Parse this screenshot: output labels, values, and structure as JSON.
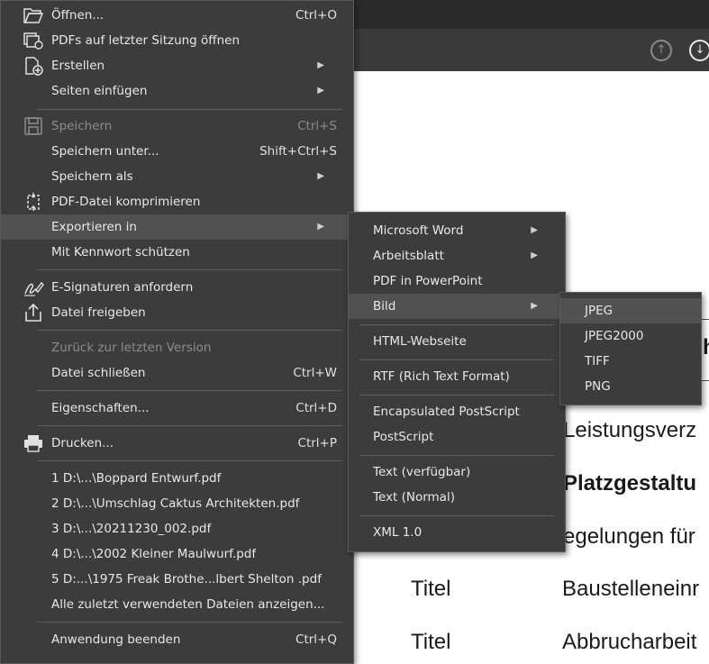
{
  "toolbar": {
    "up_icon": "arrow-up-circle-icon",
    "down_icon": "arrow-down-circle-icon"
  },
  "document": {
    "lines": [
      "Leistungsverz",
      "Platzgestaltu",
      "egelungen für",
      "Titel",
      "Baustelleneinr",
      "Titel",
      "Abbrucharbeit",
      "h"
    ]
  },
  "file_menu": {
    "items": [
      {
        "label": "Öffnen...",
        "shortcut": "Ctrl+O",
        "icon": "folder-open-icon"
      },
      {
        "label": "PDFs auf letzter Sitzung öffnen",
        "icon": "pdf-session-icon"
      },
      {
        "label": "Erstellen",
        "icon": "create-pdf-icon"
      },
      {
        "label": "Seiten einfügen"
      },
      {
        "label": "Speichern",
        "shortcut": "Ctrl+S",
        "icon": "save-icon"
      },
      {
        "label": "Speichern unter...",
        "shortcut": "Shift+Ctrl+S"
      },
      {
        "label": "Speichern als"
      },
      {
        "label": "PDF-Datei komprimieren",
        "icon": "compress-icon"
      },
      {
        "label": "Exportieren in"
      },
      {
        "label": "Mit Kennwort schützen"
      },
      {
        "label": "E-Signaturen anfordern",
        "icon": "signature-icon"
      },
      {
        "label": "Datei freigeben",
        "icon": "share-icon"
      },
      {
        "label": "Zurück zur letzten Version"
      },
      {
        "label": "Datei schließen",
        "shortcut": "Ctrl+W"
      },
      {
        "label": "Eigenschaften...",
        "shortcut": "Ctrl+D"
      },
      {
        "label": "Drucken...",
        "shortcut": "Ctrl+P",
        "icon": "printer-icon"
      },
      {
        "label": "1 D:\\...\\Boppard Entwurf.pdf"
      },
      {
        "label": "2 D:\\...\\Umschlag Caktus Architekten.pdf"
      },
      {
        "label": "3 D:\\...\\20211230_002.pdf"
      },
      {
        "label": "4 D:\\...\\2002 Kleiner Maulwurf.pdf"
      },
      {
        "label": "5 D:...\\1975 Freak Brothe...lbert Shelton .pdf"
      },
      {
        "label": "Alle zuletzt verwendeten Dateien anzeigen..."
      },
      {
        "label": "Anwendung beenden",
        "shortcut": "Ctrl+Q"
      }
    ]
  },
  "export_menu": {
    "items": [
      {
        "label": "Microsoft Word"
      },
      {
        "label": "Arbeitsblatt"
      },
      {
        "label": "PDF in PowerPoint"
      },
      {
        "label": "Bild"
      },
      {
        "label": "HTML-Webseite"
      },
      {
        "label": "RTF (Rich Text Format)"
      },
      {
        "label": "Encapsulated PostScript"
      },
      {
        "label": "PostScript"
      },
      {
        "label": "Text (verfügbar)"
      },
      {
        "label": "Text (Normal)"
      },
      {
        "label": "XML 1.0"
      }
    ]
  },
  "image_menu": {
    "items": [
      {
        "label": "JPEG"
      },
      {
        "label": "JPEG2000"
      },
      {
        "label": "TIFF"
      },
      {
        "label": "PNG"
      }
    ]
  },
  "colors": {
    "menu_bg": "#3c3c3c",
    "highlight": "#515151",
    "text": "#e8e8e8",
    "disabled": "#8c8c8c"
  }
}
